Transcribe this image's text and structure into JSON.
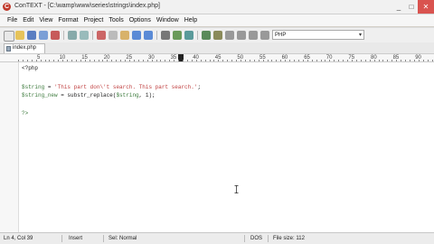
{
  "window": {
    "title": "ConTEXT - [C:\\wamp\\www\\series\\strings\\index.php]",
    "minimize": "_",
    "maximize": "□",
    "close": "✕"
  },
  "menu": [
    "File",
    "Edit",
    "View",
    "Format",
    "Project",
    "Tools",
    "Options",
    "Window",
    "Help"
  ],
  "toolbar": {
    "language": "PHP"
  },
  "tabs": [
    {
      "label": "index.php"
    }
  ],
  "ruler": {
    "marks": [
      "5",
      "10",
      "15",
      "20",
      "25",
      "30",
      "35",
      "40",
      "45",
      "50",
      "55",
      "60",
      "65",
      "70",
      "75",
      "80",
      "85",
      "90",
      "95",
      "10"
    ]
  },
  "code": {
    "line1": "<?php",
    "line3_var": "$string",
    "line3_op": " = ",
    "line3_str": "'This part don\\'t search. This part search.'",
    "line3_end": ";",
    "line4_var": "$string_new",
    "line4_op": " = ",
    "line4_fn": "substr_replace(",
    "line4_arg": "$string",
    "line4_end": ", 1);",
    "line6": "?>"
  },
  "status": {
    "position": "Ln 4, Col 39",
    "mode": "Insert",
    "selection": "Sel: Normal",
    "line_ending": "DOS",
    "file_size": "File size: 112"
  },
  "colors": {
    "variable": "#3c7a3c",
    "string": "#c04040",
    "close_button": "#d9534f"
  }
}
